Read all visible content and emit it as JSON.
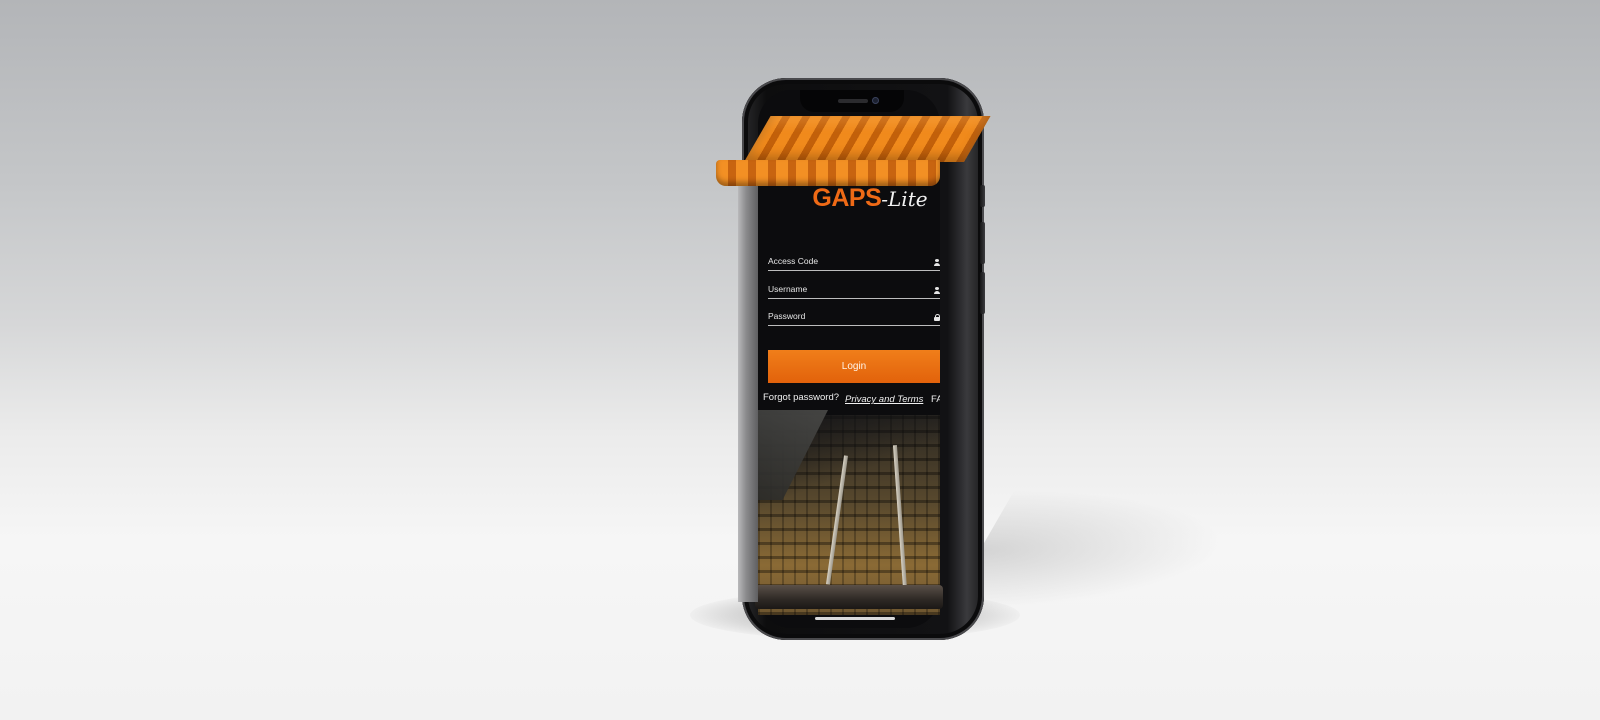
{
  "app": {
    "logo_main": "GAPS",
    "logo_sub": "-Lite"
  },
  "form": {
    "access_code_placeholder": "Access Code",
    "username_placeholder": "Username",
    "password_placeholder": "Password",
    "login_label": "Login"
  },
  "links": {
    "forgot_password": "Forgot password?",
    "privacy_terms": "Privacy and Terms",
    "faq_partial": "FA"
  },
  "icons": {
    "access_code": "user-icon",
    "username": "user-icon",
    "password": "lock-icon"
  },
  "colors": {
    "accent": "#ef6a16",
    "login_button": "#e2620b",
    "awning_light": "#f08a1c",
    "awning_dark": "#c2600a",
    "screen_bg": "#0c0c0e"
  }
}
